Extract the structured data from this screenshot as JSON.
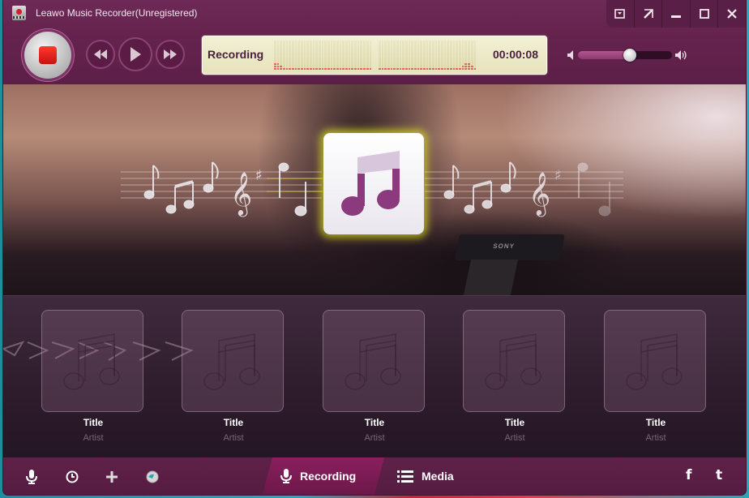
{
  "window": {
    "title": "Leawo Music Recorder(Unregistered)",
    "controls": [
      {
        "name": "menu-dropdown-button",
        "glyph": "⊡"
      },
      {
        "name": "mini-mode-button",
        "glyph": "⇱"
      },
      {
        "name": "minimize-button",
        "glyph": "—"
      },
      {
        "name": "maximize-button",
        "glyph": "☐"
      },
      {
        "name": "close-button",
        "glyph": "✕"
      }
    ]
  },
  "toolbar": {
    "status_label": "Recording",
    "elapsed_time": "00:00:08",
    "volume_percent": 55,
    "meter_left_levels": [
      3,
      3,
      2,
      1,
      1,
      1,
      1,
      1,
      1,
      1,
      1,
      1,
      1,
      1,
      1,
      1,
      1,
      1,
      1,
      1,
      1,
      1,
      1,
      1,
      1,
      1,
      1,
      1,
      1,
      1,
      1,
      1,
      1
    ],
    "meter_right_levels": [
      1,
      1,
      1,
      1,
      1,
      1,
      1,
      1,
      1,
      1,
      1,
      1,
      1,
      1,
      1,
      1,
      1,
      1,
      1,
      1,
      1,
      1,
      1,
      1,
      1,
      1,
      1,
      1,
      2,
      3,
      3,
      2,
      1
    ]
  },
  "hero": {
    "sony_text": "SONY"
  },
  "tracks": [
    {
      "title": "Title",
      "artist": "Artist"
    },
    {
      "title": "Title",
      "artist": "Artist"
    },
    {
      "title": "Title",
      "artist": "Artist"
    },
    {
      "title": "Title",
      "artist": "Artist"
    },
    {
      "title": "Title",
      "artist": "Artist"
    }
  ],
  "bottombar": {
    "tabs": [
      {
        "label": "Recording",
        "icon": "microphone-icon",
        "active": true
      },
      {
        "label": "Media",
        "icon": "list-icon",
        "active": false
      }
    ],
    "social": {
      "facebook": "f",
      "twitter": "t"
    }
  },
  "colors": {
    "window_bg": "#5e2149",
    "active_tab": "#8a1f5e",
    "status_panel": "#f3f0d6",
    "stop_red": "#e0201a",
    "icon_accent": "#8c3a7e"
  }
}
